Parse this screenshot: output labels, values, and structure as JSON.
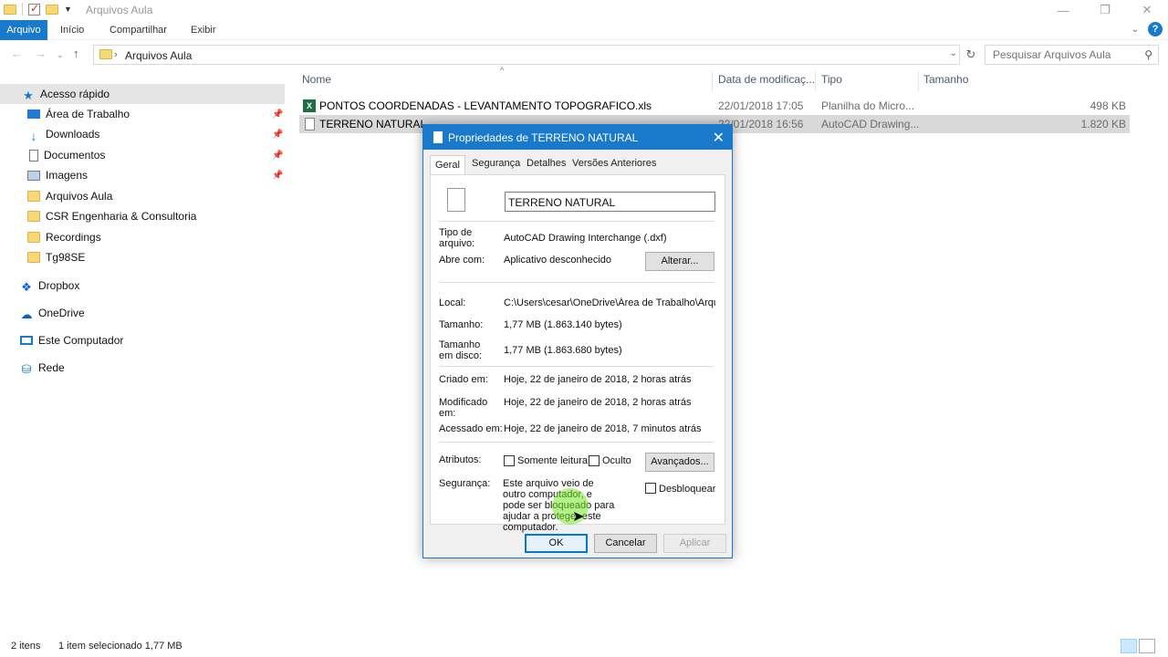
{
  "window": {
    "title": "Arquivos Aula",
    "controls": {
      "minimize": "—",
      "restore": "❐",
      "close": "✕"
    }
  },
  "ribbon": {
    "tabs": [
      "Arquivo",
      "Início",
      "Compartilhar",
      "Exibir"
    ],
    "accent": "#1979ca",
    "help": "?"
  },
  "address": {
    "path": "Arquivos Aula",
    "search_placeholder": "Pesquisar Arquivos Aula"
  },
  "sidebar": {
    "quick_access": "Acesso rápido",
    "items": [
      {
        "label": "Área de Trabalho",
        "icon": "desktop-icon",
        "pinned": true
      },
      {
        "label": "Downloads",
        "icon": "download-icon",
        "pinned": true
      },
      {
        "label": "Documentos",
        "icon": "document-icon",
        "pinned": true
      },
      {
        "label": "Imagens",
        "icon": "picture-icon",
        "pinned": true
      },
      {
        "label": "Arquivos Aula",
        "icon": "folder-icon",
        "pinned": false
      },
      {
        "label": "CSR Engenharia & Consultoria",
        "icon": "folder-icon",
        "pinned": false
      },
      {
        "label": "Recordings",
        "icon": "folder-icon",
        "pinned": false
      },
      {
        "label": "Tg98SE",
        "icon": "folder-icon",
        "pinned": false
      }
    ],
    "roots": [
      {
        "label": "Dropbox",
        "icon": "dropbox-icon"
      },
      {
        "label": "OneDrive",
        "icon": "cloud-icon"
      },
      {
        "label": "Este Computador",
        "icon": "computer-icon"
      },
      {
        "label": "Rede",
        "icon": "network-icon"
      }
    ]
  },
  "files": {
    "columns": [
      "Nome",
      "Data de modificaç...",
      "Tipo",
      "Tamanho"
    ],
    "rows": [
      {
        "name": "PONTOS COORDENADAS - LEVANTAMENTO TOPOGRAFICO.xls",
        "date": "22/01/2018 17:05",
        "type": "Planilha do Micro...",
        "size": "498 KB",
        "icon": "excel-icon"
      },
      {
        "name": "TERRENO NATURAL",
        "date": "22/01/2018 16:56",
        "type": "AutoCAD Drawing...",
        "size": "1.820 KB",
        "icon": "file-icon"
      }
    ]
  },
  "status": {
    "count": "2 itens",
    "selection": "1 item selecionado  1,77 MB"
  },
  "dialog": {
    "title": "Propriedades de TERRENO NATURAL",
    "tabs": [
      "Geral",
      "Segurança",
      "Detalhes",
      "Versões Anteriores"
    ],
    "name": "TERRENO NATURAL",
    "type_label": "Tipo de arquivo:",
    "type_value": "AutoCAD Drawing Interchange (.dxf)",
    "opens_label": "Abre com:",
    "opens_value": "Aplicativo desconhecido",
    "change_button": "Alterar...",
    "location_label": "Local:",
    "location_value": "C:\\Users\\cesar\\OneDrive\\Área de Trabalho\\Arquivos",
    "size_label": "Tamanho:",
    "size_value": "1,77 MB (1.863.140 bytes)",
    "disk_label": "Tamanho em disco:",
    "disk_value": "1,77 MB (1.863.680 bytes)",
    "created_label": "Criado em:",
    "created_value": "Hoje, 22 de janeiro de 2018, 2 horas atrás",
    "modified_label": "Modificado em:",
    "modified_value": "Hoje, 22 de janeiro de 2018, 2 horas atrás",
    "accessed_label": "Acessado em:",
    "accessed_value": "Hoje, 22 de janeiro de 2018, 7 minutos atrás",
    "attributes_label": "Atributos:",
    "readonly_label": "Somente leitura",
    "hidden_label": "Oculto",
    "advanced_button": "Avançados...",
    "security_label": "Segurança:",
    "security_text": "Este arquivo veio de outro computador, e pode ser bloqueado para ajudar a proteger este computador.",
    "unblock_label": "Desbloquear",
    "ok": "OK",
    "cancel": "Cancelar",
    "apply": "Aplicar"
  }
}
